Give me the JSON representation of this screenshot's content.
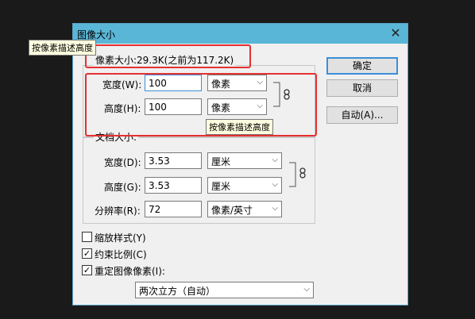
{
  "dialog": {
    "title": "图像大小",
    "close_glyph": "✕"
  },
  "pixel_size": {
    "legend": "像素大小:29.3K(之前为117.2K)",
    "width_label": "宽度(W):",
    "width_value": "100",
    "width_unit": "像素",
    "height_label": "高度(H):",
    "height_value": "100",
    "height_unit": "像素"
  },
  "doc_size": {
    "legend": "文档大小:",
    "width_label": "宽度(D):",
    "width_value": "3.53",
    "width_unit": "厘米",
    "height_label": "高度(G):",
    "height_value": "3.53",
    "height_unit": "厘米",
    "resolution_label": "分辨率(R):",
    "resolution_value": "72",
    "resolution_unit": "像素/英寸"
  },
  "buttons": {
    "ok": "确定",
    "cancel": "取消",
    "auto": "自动(A)..."
  },
  "options": {
    "scale_styles": {
      "label": "缩放样式(Y)",
      "checked": false
    },
    "constrain_proportions": {
      "label": "约束比例(C)",
      "checked": true
    },
    "resample": {
      "label": "重定图像像素(I):",
      "checked": true
    },
    "resample_method": "两次立方（自动）"
  },
  "tooltips": {
    "top": "按像素描述高度",
    "middle": "按像素描述高度"
  },
  "colors": {
    "titlebar": "#5ab6d6",
    "highlight_box": "#e53030"
  },
  "icons": {
    "link": "chain-link-icon",
    "dropdown": "chevron-down-icon",
    "check": "checkmark-icon"
  }
}
